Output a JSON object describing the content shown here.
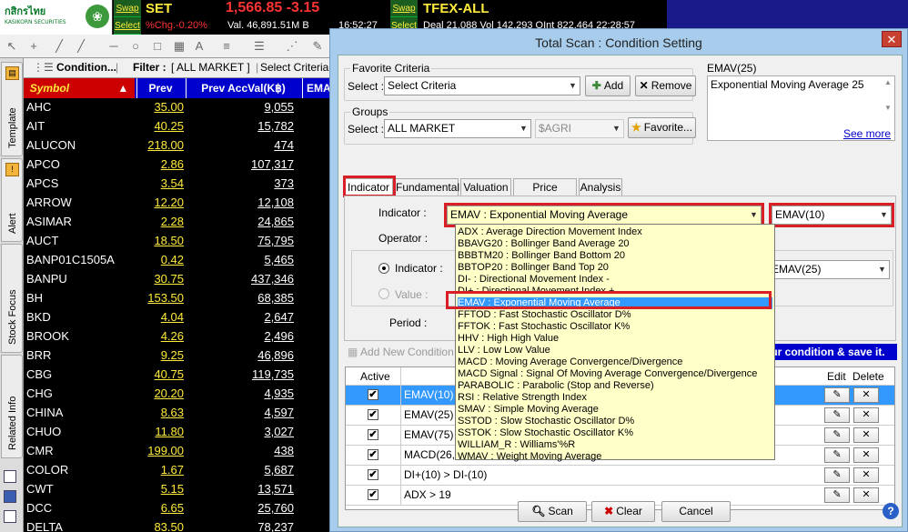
{
  "topbar": {
    "logo_text": "กสิกรไทย",
    "logo_sub": "KASIKORN SECURITIES",
    "swap1": "Swap",
    "select1": "Select",
    "set_label": "SET",
    "set_price": "1,566.85 -3.15",
    "set_change": "%Chg.-0.20%",
    "set_val": "Val. 46,891.51M B",
    "set_time": "16:52:27",
    "swap2": "Swap",
    "select2": "Select",
    "tfex_label": "TFEX-ALL",
    "tfex_line": "Deal 21,088  Vol 142,293  OInt 822,464 22:28:57"
  },
  "list": {
    "condition_label": "Condition...",
    "filter_label": "Filter :",
    "filter_value": "[ ALL MARKET ]",
    "select_criteria": "Select Criteria",
    "headers": {
      "symbol": "Symbol",
      "prev": "Prev",
      "accval": "Prev AccVal(K฿)",
      "ema": "EMA"
    },
    "rows": [
      {
        "s": "AHC",
        "p": "35.00",
        "a": "9,055"
      },
      {
        "s": "AIT",
        "p": "40.25",
        "a": "15,782"
      },
      {
        "s": "ALUCON",
        "p": "218.00",
        "a": "474"
      },
      {
        "s": "APCO",
        "p": "2.86",
        "a": "107,317"
      },
      {
        "s": "APCS",
        "p": "3.54",
        "a": "373"
      },
      {
        "s": "ARROW",
        "p": "12.20",
        "a": "12,108"
      },
      {
        "s": "ASIMAR",
        "p": "2.28",
        "a": "24,865"
      },
      {
        "s": "AUCT",
        "p": "18.50",
        "a": "75,795"
      },
      {
        "s": "BANP01C1505A",
        "p": "0.42",
        "a": "5,465"
      },
      {
        "s": "BANPU",
        "p": "30.75",
        "a": "437,346"
      },
      {
        "s": "BH",
        "p": "153.50",
        "a": "68,385"
      },
      {
        "s": "BKD",
        "p": "4.04",
        "a": "2,647"
      },
      {
        "s": "BROOK",
        "p": "4.26",
        "a": "2,496"
      },
      {
        "s": "BRR",
        "p": "9.25",
        "a": "46,896"
      },
      {
        "s": "CBG",
        "p": "40.75",
        "a": "119,735"
      },
      {
        "s": "CHG",
        "p": "20.20",
        "a": "4,935"
      },
      {
        "s": "CHINA",
        "p": "8.63",
        "a": "4,597"
      },
      {
        "s": "CHUO",
        "p": "11.80",
        "a": "3,027"
      },
      {
        "s": "CMR",
        "p": "199.00",
        "a": "438"
      },
      {
        "s": "COLOR",
        "p": "1.67",
        "a": "5,687"
      },
      {
        "s": "CWT",
        "p": "5.15",
        "a": "13,571"
      },
      {
        "s": "DCC",
        "p": "6.65",
        "a": "25,760"
      },
      {
        "s": "DELTA",
        "p": "83.50",
        "a": "78,237"
      }
    ]
  },
  "sidetabs": [
    "Template",
    "Alert",
    "Stock Focus",
    "Related Info"
  ],
  "dialog": {
    "title": "Total Scan : Condition Setting",
    "fav_group": "Favorite Criteria",
    "select_label": "Select :",
    "fav_select": "Select Criteria",
    "add": "Add",
    "remove": "Remove",
    "groups_group": "Groups",
    "group_select": "ALL MARKET",
    "sector_select": "$AGRI",
    "favorite_btn": "Favorite...",
    "desc_title": "EMAV(25)",
    "desc_text": "Exponential Moving Average 25",
    "see_more": "See more",
    "tabs": [
      "Indicator",
      "Fundamental",
      "Valuation",
      "Price Pattern",
      "Analysis"
    ],
    "indicator_label": "Indicator :",
    "indicator_value": "EMAV : Exponential Moving Average",
    "param_value": "EMAV(10)",
    "operator_label": "Operator :",
    "radio_indicator": "Indicator :",
    "radio_value": "Value :",
    "compare_value": "EMAV(25)",
    "period_label": "Period :",
    "add_new": "Add New Condition",
    "hint": "our condition & save it.",
    "options": [
      "ADX : Average Direction Movement Index",
      "BBAVG20 : Bollinger Band Average 20",
      "BBBTM20 : Bollinger Band  Bottom 20",
      "BBTOP20 : Bollinger Band  Top 20",
      "DI- : Directional Movement Index -",
      "DI+ : Directional Movement Index +",
      "EMAV : Exponential Moving Average",
      "FFTOD : Fast Stochastic Oscillator D%",
      "FFTOK : Fast Stochastic Oscillator K%",
      "HHV : High High Value",
      "LLV : Low Low Value",
      "MACD : Moving Average Convergence/Divergence",
      "MACD Signal : Signal Of Moving Average Convergence/Divergence",
      "PARABOLIC : Parabolic (Stop and Reverse)",
      "RSI : Relative Strength Index",
      "SMAV : Simple Moving Average",
      "SSTOD : Slow Stochastic Oscillator D%",
      "SSTOK : Slow Stochastic Oscillator K%",
      "WILLIAM_R : Williams'%R",
      "WMAV : Weight Moving Average"
    ],
    "grid_headers": {
      "active": "Active",
      "edit": "Edit",
      "delete": "Delete"
    },
    "conditions": [
      "EMAV(10)",
      "EMAV(25)",
      "EMAV(75)",
      "MACD(26,",
      "DI+(10) > DI-(10)",
      "ADX > 19"
    ],
    "scan": "Scan",
    "clear": "Clear",
    "cancel": "Cancel"
  }
}
